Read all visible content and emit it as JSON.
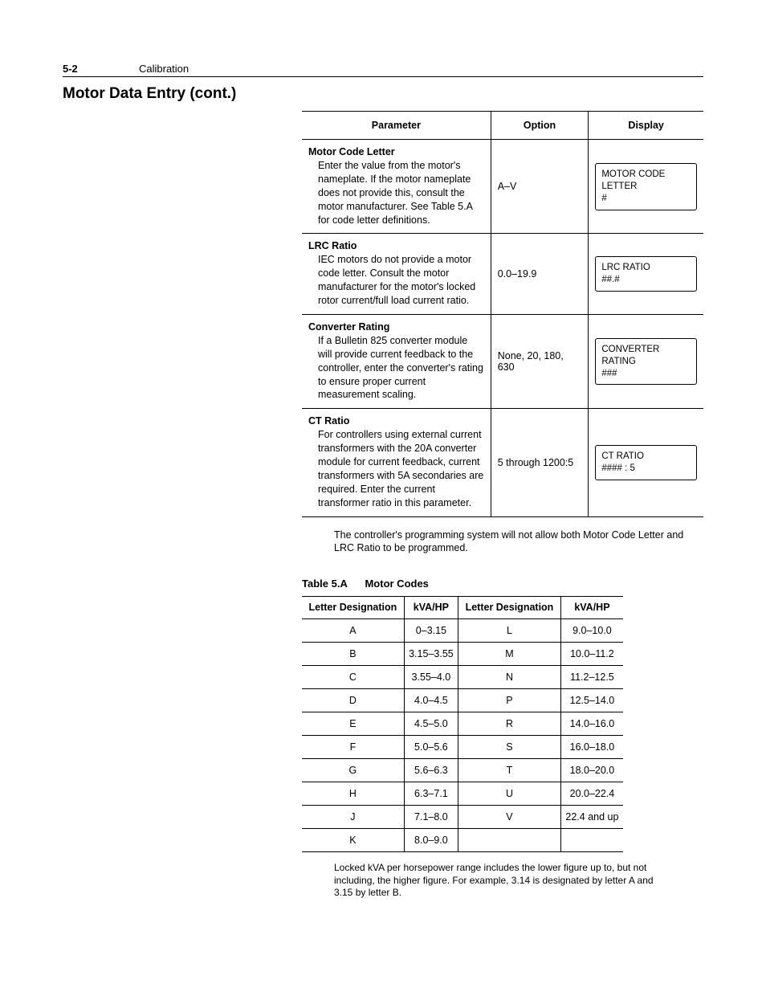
{
  "header": {
    "page_num": "5-2",
    "section": "Calibration"
  },
  "section_title": "Motor Data Entry (cont.)",
  "param_table": {
    "headers": [
      "Parameter",
      "Option",
      "Display"
    ],
    "rows": [
      {
        "name": "Motor Code Letter",
        "desc": "Enter the value from the motor's nameplate.  If the motor nameplate does not provide this, consult the motor manufacturer.  See Table 5.A for code letter definitions.",
        "option": "A–V",
        "display_l1": "MOTOR CODE LETTER",
        "display_l2": "#"
      },
      {
        "name": "LRC Ratio",
        "desc": "IEC motors do not provide a motor code letter.  Consult the motor manufacturer for the motor's locked rotor current/full load current ratio.",
        "option": "0.0–19.9",
        "display_l1": "LRC RATIO",
        "display_l2": "##.#"
      },
      {
        "name": "Converter Rating",
        "desc": "If a Bulletin 825 converter module will provide current feedback to the controller, enter the converter's rating to ensure proper current measurement scaling.",
        "option": "None, 20, 180, 630",
        "display_l1": "CONVERTER RATING",
        "display_l2": "###"
      },
      {
        "name": "CT Ratio",
        "desc": "For controllers using external current transformers with the 20A converter module for current feedback, current transformers with 5A secondaries are required.  Enter the current transformer ratio in this parameter.",
        "option": "5 through 1200:5",
        "display_l1": "CT RATIO",
        "display_l2": "#### : 5"
      }
    ]
  },
  "note1": "The controller's programming system will not allow both Motor Code Letter and LRC Ratio to be programmed.",
  "codes_caption": {
    "label": "Table 5.A",
    "title": "Motor Codes"
  },
  "codes_table": {
    "headers": [
      "Letter Designation",
      "kVA/HP",
      "Letter Designation",
      "kVA/HP"
    ],
    "rows": [
      [
        "A",
        "0–3.15",
        "L",
        "9.0–10.0"
      ],
      [
        "B",
        "3.15–3.55",
        "M",
        "10.0–11.2"
      ],
      [
        "C",
        "3.55–4.0",
        "N",
        "11.2–12.5"
      ],
      [
        "D",
        "4.0–4.5",
        "P",
        "12.5–14.0"
      ],
      [
        "E",
        "4.5–5.0",
        "R",
        "14.0–16.0"
      ],
      [
        "F",
        "5.0–5.6",
        "S",
        "16.0–18.0"
      ],
      [
        "G",
        "5.6–6.3",
        "T",
        "18.0–20.0"
      ],
      [
        "H",
        "6.3–7.1",
        "U",
        "20.0–22.4"
      ],
      [
        "J",
        "7.1–8.0",
        "V",
        "22.4 and up"
      ],
      [
        "K",
        "8.0–9.0",
        "",
        ""
      ]
    ]
  },
  "note2": "Locked kVA per horsepower range includes the lower figure up to, but not including, the higher figure.  For example, 3.14 is designated by letter A and 3.15 by letter B."
}
